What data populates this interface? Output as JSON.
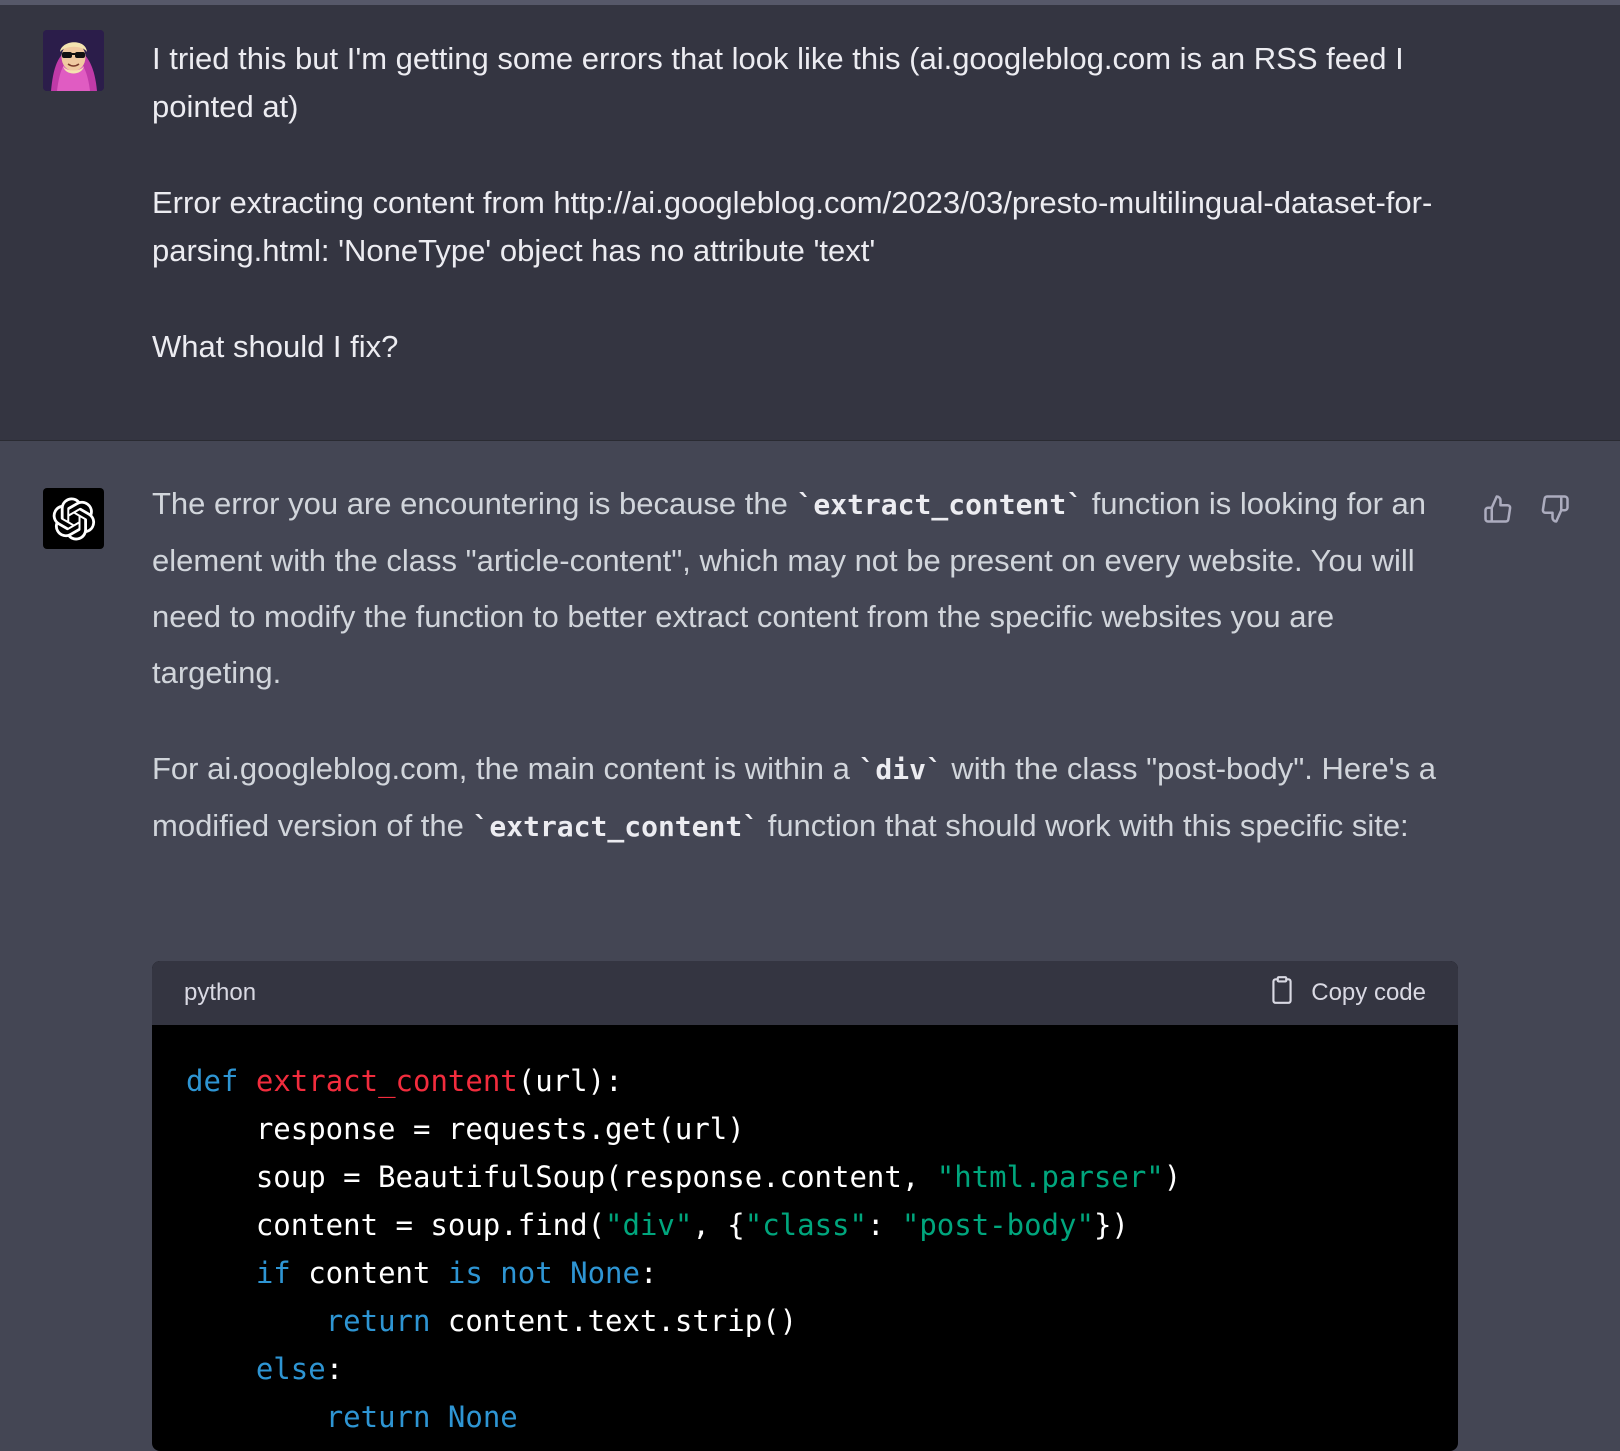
{
  "user_message": {
    "para1": "I tried this but I'm getting some errors that look like this (ai.googleblog.com is an RSS feed I pointed at)",
    "para2": "Error extracting content from http://ai.googleblog.com/2023/03/presto-multilingual-dataset-for-parsing.html: 'NoneType' object has no attribute 'text'",
    "para3": "What should I fix?"
  },
  "assistant_message": {
    "p1_a": "The error you are encountering is because the ",
    "p1_code": "`extract_content`",
    "p1_b": " function is looking for an element with the class \"article-content\", which may not be present on every website. You will need to modify the function to better extract content from the specific websites you are targeting.",
    "p2_a": "For ai.googleblog.com, the main content is within a ",
    "p2_code1": "`div`",
    "p2_b": " with the class \"post-body\". Here's a modified version of the ",
    "p2_code2": "`extract_content`",
    "p2_c": " function that should work with this specific site:"
  },
  "code_block": {
    "language": "python",
    "copy_label": "Copy code",
    "tokens": {
      "def": "def",
      "fn_name": "extract_content",
      "sig_rest": "(url):",
      "line2": "    response = requests.get(url)",
      "line3_a": "    soup = BeautifulSoup(response.content, ",
      "line3_str": "\"html.parser\"",
      "line3_b": ")",
      "line4_a": "    content = soup.find(",
      "line4_str1": "\"div\"",
      "line4_b": ", {",
      "line4_str2": "\"class\"",
      "line4_c": ": ",
      "line4_str3": "\"post-body\"",
      "line4_d": "})",
      "line5_indent": "    ",
      "line5_if": "if",
      "line5_mid": " content ",
      "line5_isnot": "is not",
      "line5_sp": " ",
      "line5_none": "None",
      "line5_end": ":",
      "line6_indent": "        ",
      "line6_return": "return",
      "line6_rest": " content.text.strip()",
      "line7_indent": "    ",
      "line7_else": "else",
      "line7_end": ":",
      "line8_indent": "        ",
      "line8_return": "return",
      "line8_sp": " ",
      "line8_none": "None"
    }
  },
  "icons": {
    "user_avatar": "user-avatar-image",
    "assistant_avatar": "openai-logo-icon",
    "thumbs_up": "thumbs-up-icon",
    "thumbs_down": "thumbs-down-icon",
    "clipboard": "clipboard-icon"
  },
  "colors": {
    "user_bg": "#343541",
    "assistant_bg": "#444654",
    "keyword": "#2e95d3",
    "function_name": "#f22c3d",
    "string": "#00a67d"
  }
}
